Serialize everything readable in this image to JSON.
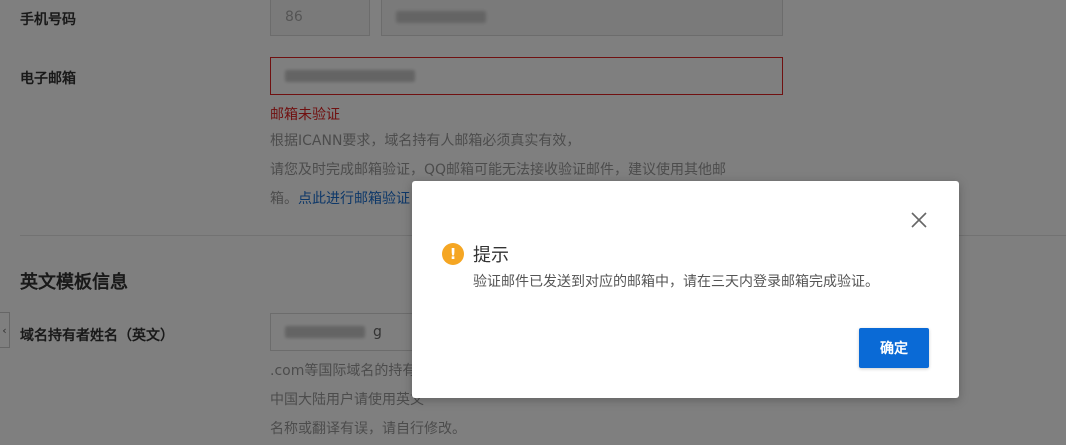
{
  "form": {
    "phone": {
      "label": "手机号码",
      "country_code": "86"
    },
    "email": {
      "label": "电子邮箱",
      "error": "邮箱未验证"
    },
    "email_hint": {
      "line1": "根据ICANN要求，域名持有人邮箱必须真实有效，",
      "line2": "请您及时完成邮箱验证，QQ邮箱可能无法接收验证邮件，建议使用其他邮",
      "line3_prefix": "箱。",
      "link": "点此进行邮箱验证"
    },
    "section_title": "英文模板信息",
    "owner_en": {
      "label": "域名持有者姓名（英文）",
      "value_tail": "g"
    },
    "owner_hint": {
      "line1": ".com等国际域名的持有",
      "line2": "中国大陆用户请使用英文",
      "line3": "名称或翻译有误，请自行修改。"
    }
  },
  "side_tab": {
    "glyph": "‹"
  },
  "dialog": {
    "title": "提示",
    "message": "验证邮件已发送到对应的邮箱中，请在三天内登录邮箱完成验证。",
    "ok_label": "确定",
    "icon": "warning-icon",
    "close_icon": "close-icon"
  },
  "colors": {
    "error": "#e02020",
    "link": "#1a6fd1",
    "primary_button": "#0a6ad6",
    "warning": "#f5a623"
  }
}
